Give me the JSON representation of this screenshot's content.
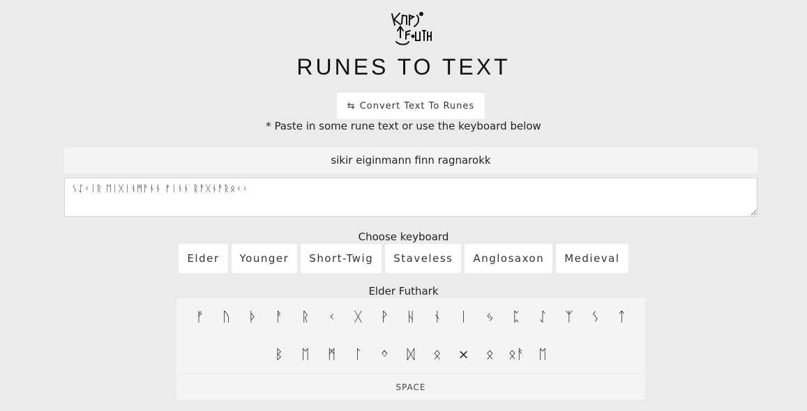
{
  "header": {
    "title": "RUNES TO TEXT",
    "convert_button": "Convert Text To Runes",
    "hint": "* Paste in some rune text or use the keyboard below"
  },
  "translation": {
    "latin_output": "sikir eiginmann finn ragnarokk",
    "rune_input": "ᛊᛇᚲᛁᚱ ᛖᛁᚷᛁᚾᛗᚨᚾᚾ ᚠᛁᚾᚾ ᚱᚨᚷᚾᚨᚱᛟᚲᚲ"
  },
  "keyboard_picker": {
    "label": "Choose keyboard",
    "options": [
      "Elder",
      "Younger",
      "Short-Twig",
      "Staveless",
      "Anglosaxon",
      "Medieval"
    ]
  },
  "keyboard": {
    "name": "Elder Futhark",
    "row1": [
      "ᚠ",
      "ᚢ",
      "ᚦ",
      "ᚨ",
      "ᚱ",
      "ᚲ",
      "ᚷ",
      "ᚹ",
      "ᚺ",
      "ᚾ",
      "ᛁ",
      "ᛃ",
      "ᛈ",
      "ᛇ",
      "ᛉ",
      "ᛊ",
      "ᛏ"
    ],
    "row2": [
      "ᛒ",
      "ᛖ",
      "ᛗ",
      "ᛚ",
      "ᛜ",
      "ᛞ",
      "ᛟ",
      "×",
      "ᛟ",
      "ᛟᚨ",
      "ᛖ"
    ],
    "space_label": "SPACE"
  },
  "colors": {
    "background": "#ecebe9",
    "panel": "#f5f4f2",
    "button": "#ffffff",
    "text": "#222222"
  }
}
